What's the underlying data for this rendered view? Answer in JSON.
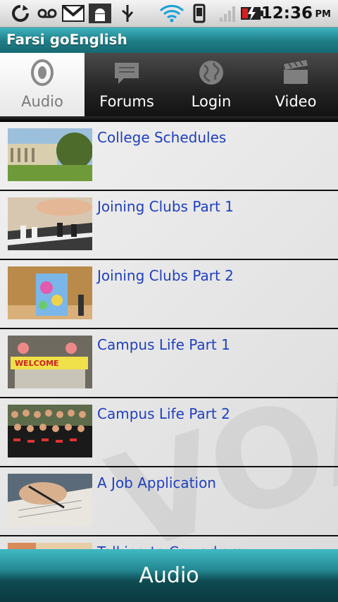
{
  "status": {
    "time": "12:36",
    "ampm": "PM"
  },
  "app": {
    "title": "Farsi goEnglish"
  },
  "tabs": [
    {
      "label": "Audio",
      "icon": "speaker-icon",
      "selected": true
    },
    {
      "label": "Forums",
      "icon": "chat-bubble-icon",
      "selected": false
    },
    {
      "label": "Login",
      "icon": "globe-icon",
      "selected": false
    },
    {
      "label": "Video",
      "icon": "clapperboard-icon",
      "selected": false
    }
  ],
  "items": [
    {
      "title": "College Schedules"
    },
    {
      "title": "Joining Clubs Part 1"
    },
    {
      "title": "Joining Clubs Part 2"
    },
    {
      "title": "Campus Life Part 1"
    },
    {
      "title": "Campus Life Part 2"
    },
    {
      "title": "A Job Application"
    },
    {
      "title": "Talking to Coworkers"
    }
  ],
  "bottom": {
    "label": "Audio"
  },
  "colors": {
    "accent": "#1e7c86",
    "link": "#1f3fbf"
  }
}
